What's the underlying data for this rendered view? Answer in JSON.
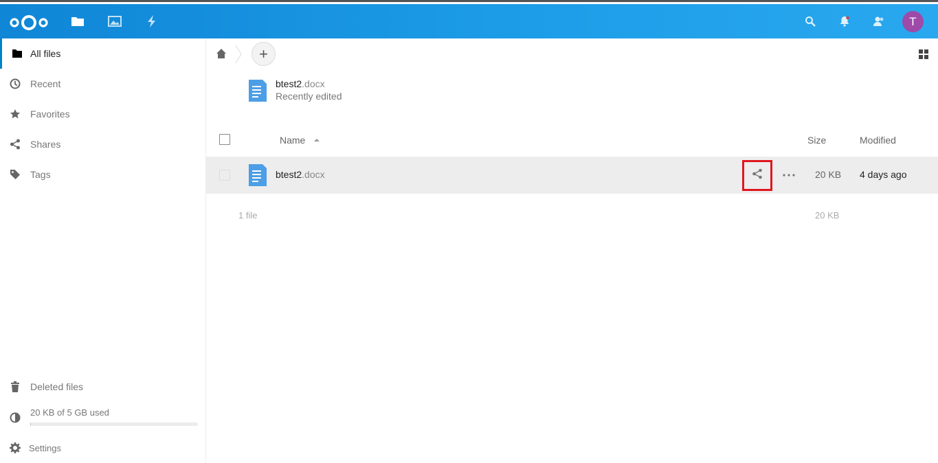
{
  "header": {
    "apps": [
      {
        "name": "files",
        "icon": "folder-icon"
      },
      {
        "name": "photos",
        "icon": "image-icon"
      },
      {
        "name": "activity",
        "icon": "lightning-icon"
      }
    ],
    "right_icons": [
      "search-icon",
      "bell-icon",
      "contacts-icon"
    ],
    "avatar_initial": "T",
    "avatar_color": "#9e4aa8",
    "accent_color": "#0082c9"
  },
  "sidebar": {
    "items": [
      {
        "label": "All files",
        "icon": "folder-icon",
        "active": true
      },
      {
        "label": "Recent",
        "icon": "clock-icon"
      },
      {
        "label": "Favorites",
        "icon": "star-icon"
      },
      {
        "label": "Shares",
        "icon": "share-icon"
      },
      {
        "label": "Tags",
        "icon": "tag-icon"
      }
    ],
    "deleted_label": "Deleted files",
    "quota_label": "20 KB of 5 GB used",
    "quota_fraction": 4e-06,
    "settings_label": "Settings"
  },
  "main": {
    "add_label": "+",
    "recent": {
      "name": "btest2",
      "ext": ".docx",
      "subtitle": "Recently edited"
    },
    "columns": {
      "name": "Name",
      "size": "Size",
      "modified": "Modified"
    },
    "files": [
      {
        "name": "btest2",
        "ext": ".docx",
        "size": "20 KB",
        "modified": "4 days ago"
      }
    ],
    "summary": {
      "count": "1 file",
      "size": "20 KB"
    }
  }
}
